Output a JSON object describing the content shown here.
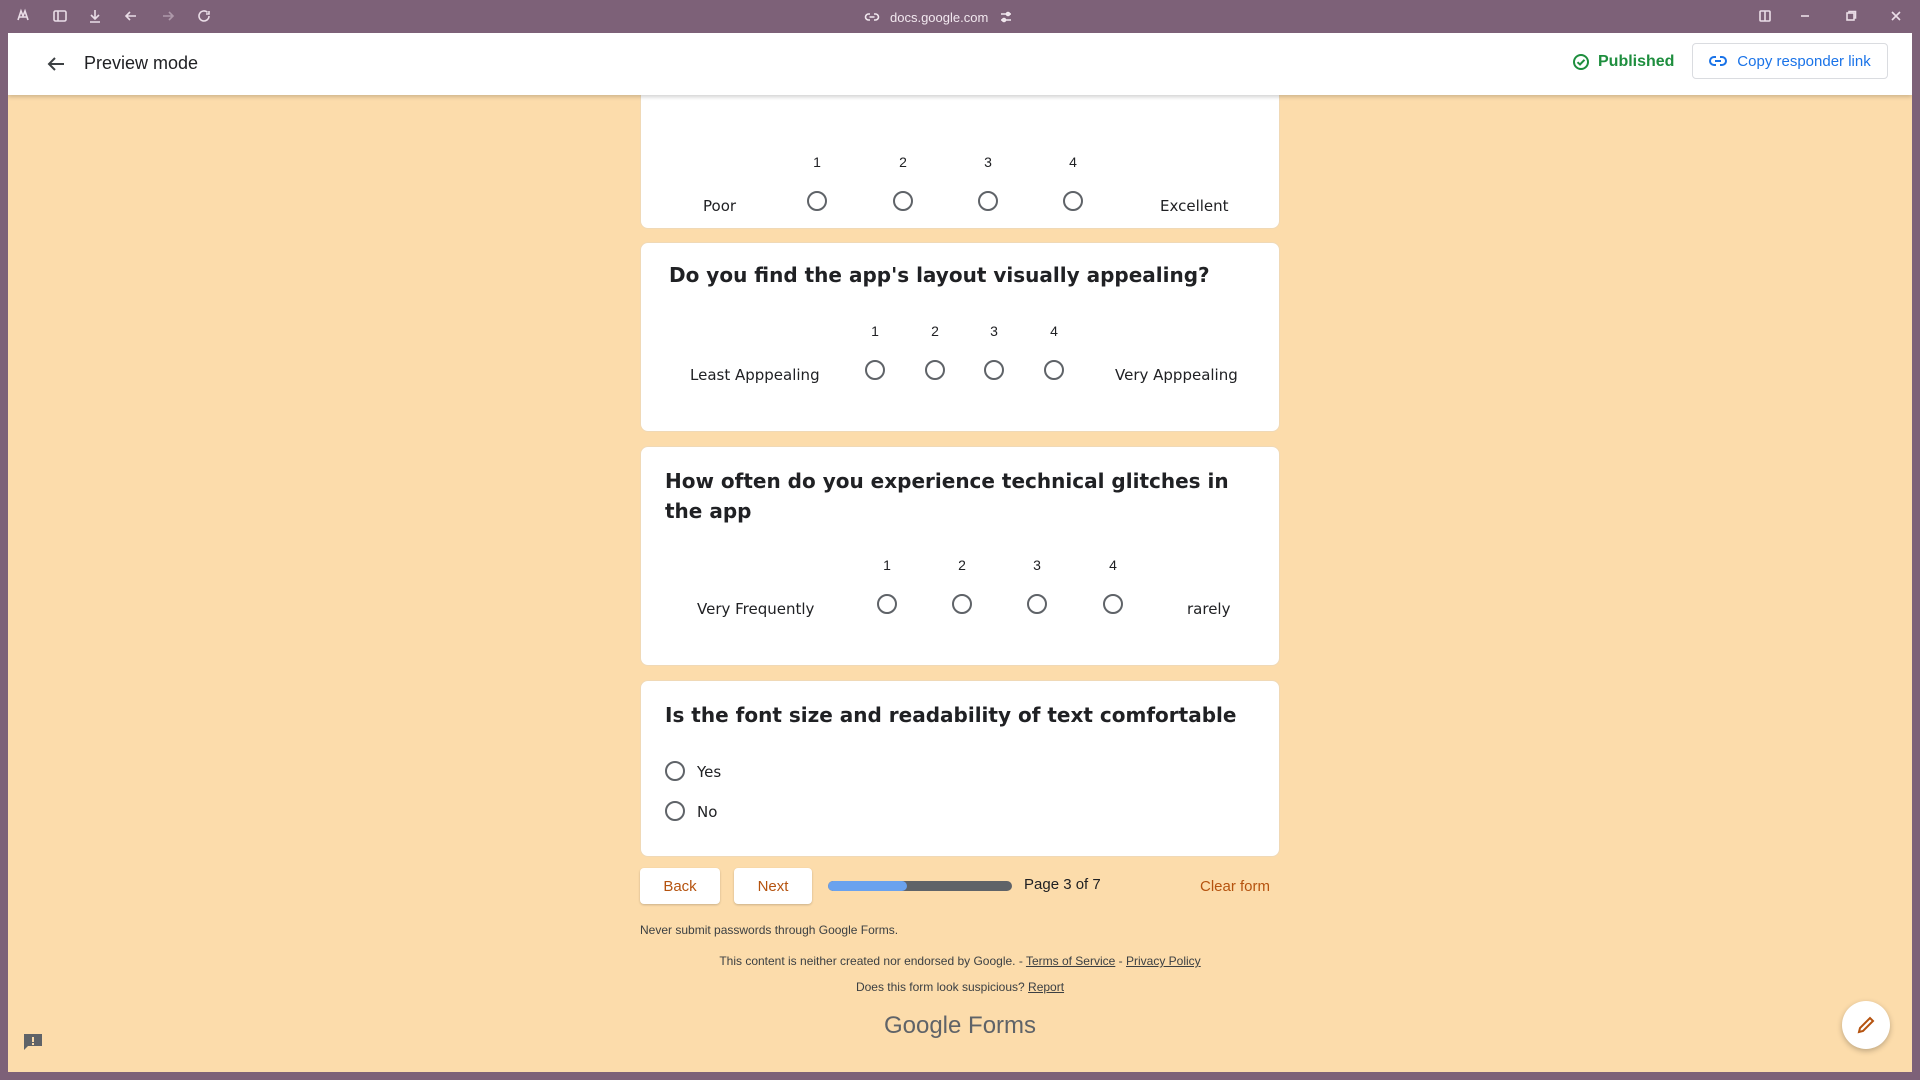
{
  "browser": {
    "url": "docs.google.com"
  },
  "header": {
    "title": "Preview mode",
    "status": "Published",
    "copy_link_label": "Copy responder link"
  },
  "colors": {
    "background": "#fcdcab",
    "accent": "#b5530f",
    "published": "#1e8e3e",
    "link": "#1a73e8",
    "progress_fill": "#6aa2ee"
  },
  "questions": [
    {
      "title": "",
      "scale": [
        "1",
        "2",
        "3",
        "4"
      ],
      "low_label": "Poor",
      "high_label": "Excellent"
    },
    {
      "title": "Do you find the app's layout visually appealing?",
      "scale": [
        "1",
        "2",
        "3",
        "4"
      ],
      "low_label": "Least Apppealing",
      "high_label": "Very Apppealing"
    },
    {
      "title": "How often do you experience technical glitches in the app",
      "scale": [
        "1",
        "2",
        "3",
        "4"
      ],
      "low_label": "Very Frequently",
      "high_label": "rarely"
    },
    {
      "title": "Is the font size and readability of text comfortable",
      "options": [
        "Yes",
        "No"
      ]
    }
  ],
  "navigation": {
    "back_label": "Back",
    "next_label": "Next",
    "page_text": "Page 3 of 7",
    "progress_fraction": 0.43,
    "clear_label": "Clear form"
  },
  "footer": {
    "password_warning": "Never submit passwords through Google Forms.",
    "disclaimer": "This content is neither created nor endorsed by Google. -",
    "terms": "Terms of Service",
    "separator": "-",
    "privacy": "Privacy Policy",
    "suspicious": "Does this form look suspicious?",
    "report": "Report",
    "logo_google": "Google",
    "logo_forms": "Forms"
  },
  "icons": {
    "browser": [
      "copilot-icon",
      "sidebar-icon",
      "download-icon",
      "back-icon",
      "forward-icon",
      "refresh-icon"
    ],
    "fab": "pencil-icon",
    "feedback": "report-problem-icon"
  }
}
